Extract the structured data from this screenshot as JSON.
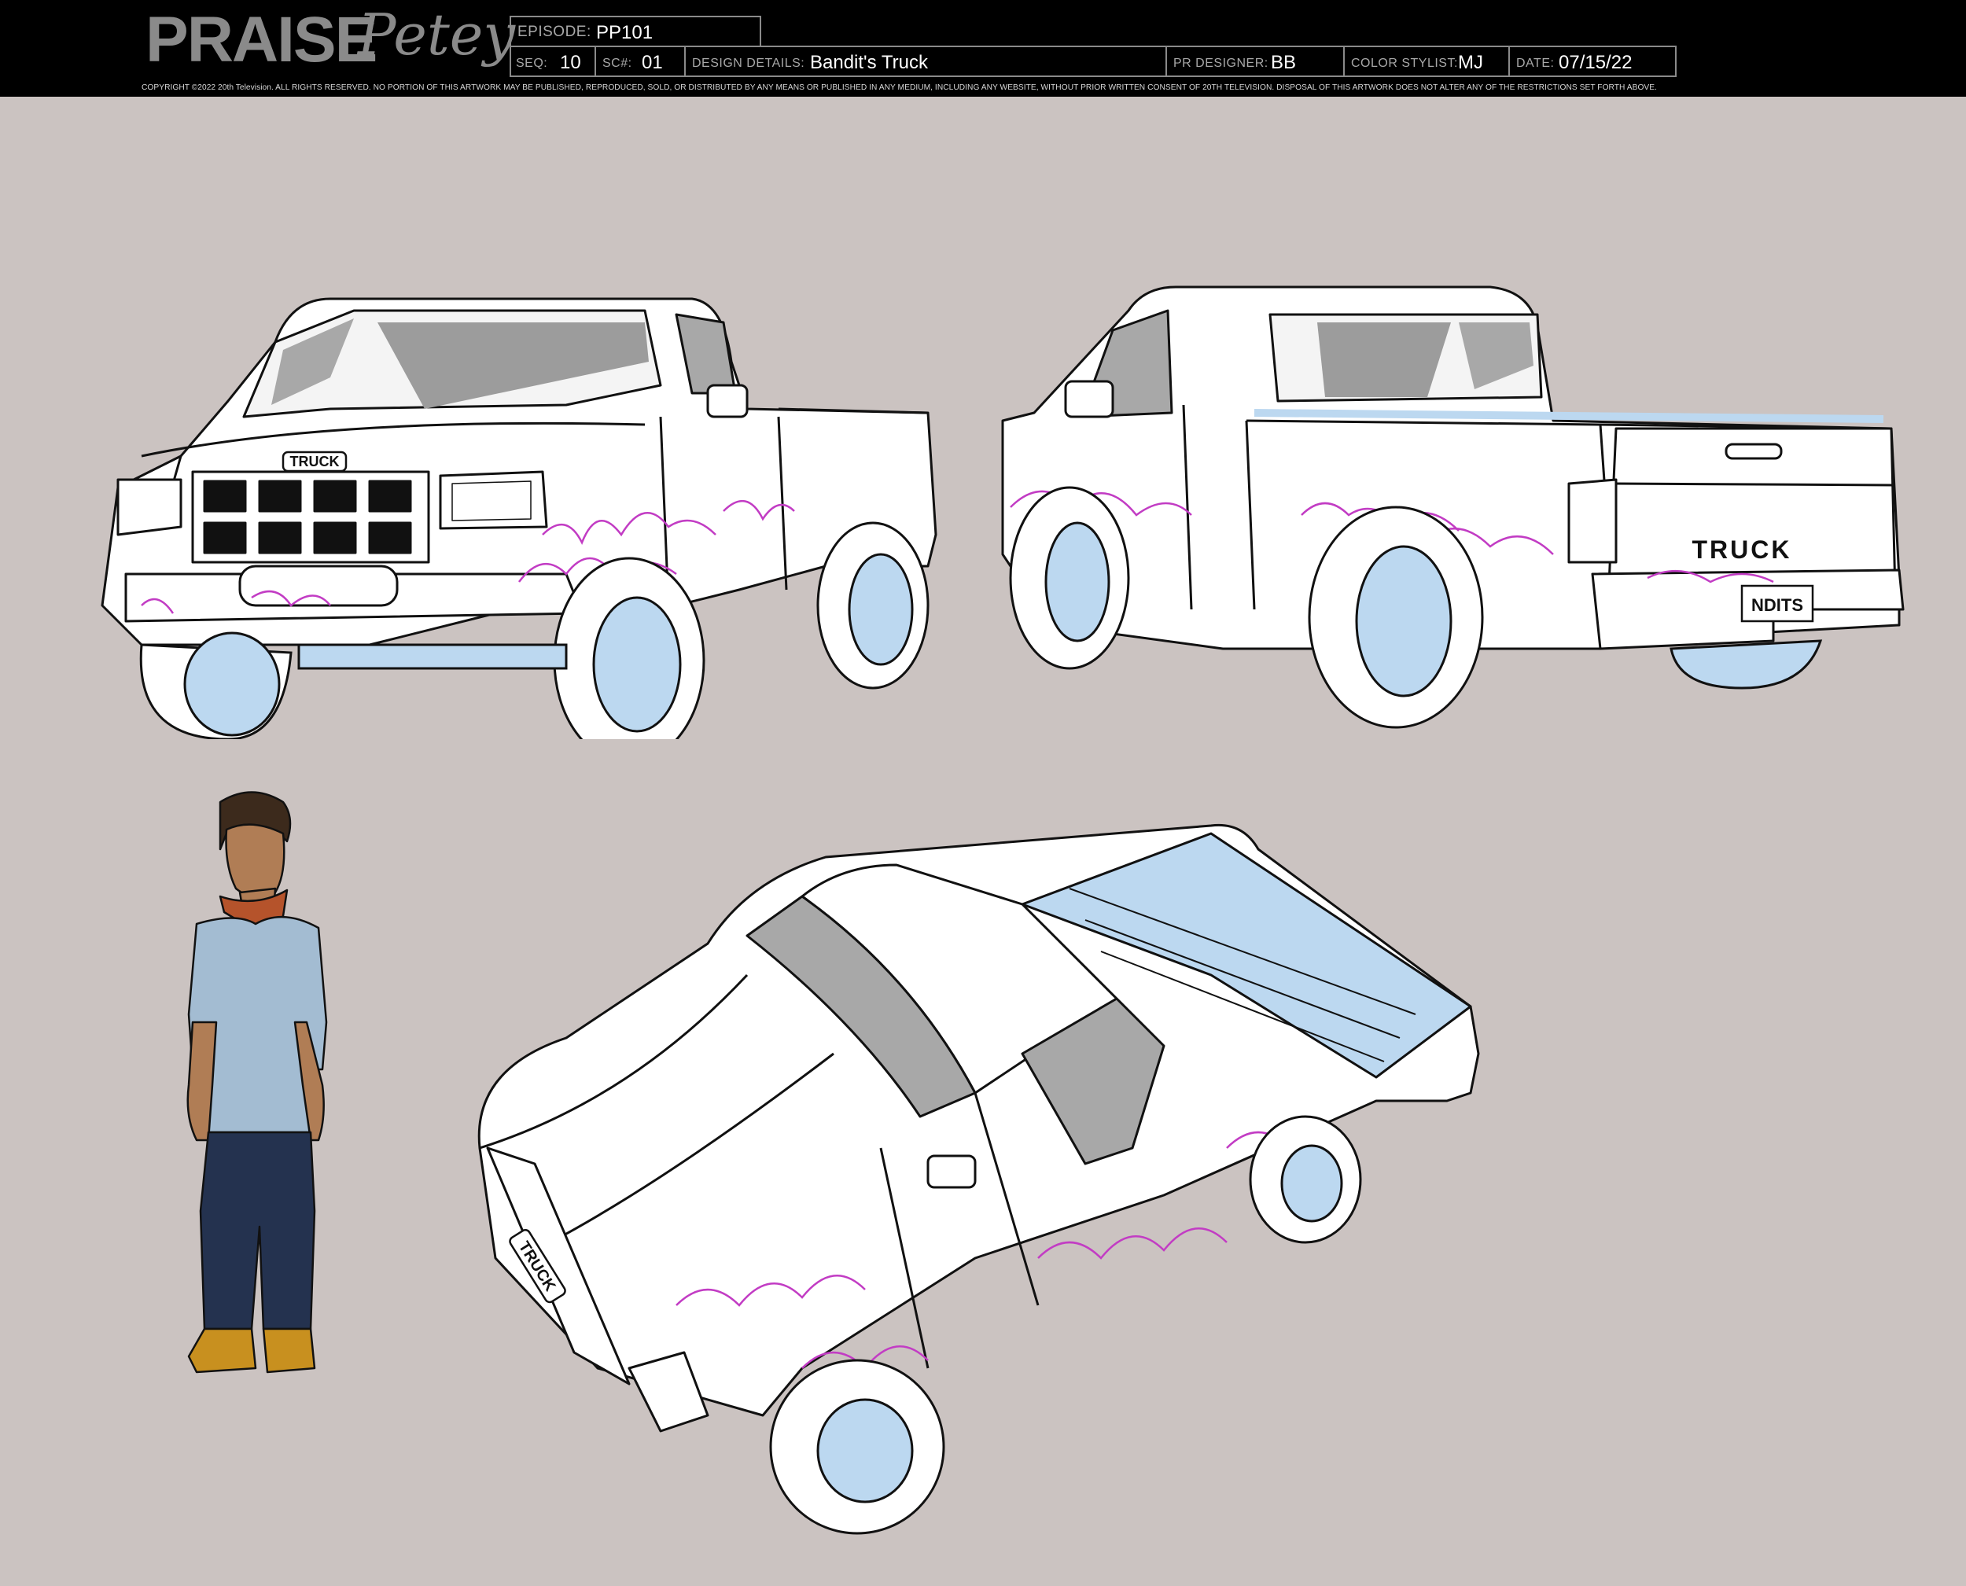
{
  "logo": {
    "word1": "PRAISE",
    "word2": "Petey"
  },
  "slate": {
    "episode_label": "EPISODE:",
    "episode_value": "PP101",
    "seq_label": "SEQ:",
    "seq_value": "10",
    "sc_label": "SC#:",
    "sc_value": "01",
    "design_label": "DESIGN DETAILS:",
    "design_value": "Bandit's Truck",
    "designer_label": "PR DESIGNER:",
    "designer_value": "BB",
    "stylist_label": "COLOR STYLIST:",
    "stylist_value": "MJ",
    "date_label": "DATE:",
    "date_value": "07/15/22"
  },
  "copyright": "COPYRIGHT ©2022 20th Television. ALL RIGHTS RESERVED. NO PORTION OF THIS ARTWORK MAY BE PUBLISHED, REPRODUCED, SOLD, OR DISTRIBUTED BY ANY MEANS OR PUBLISHED IN ANY MEDIUM, INCLUDING ANY WEBSITE, WITHOUT PRIOR WRITTEN CONSENT OF 20TH TELEVISION. DISPOSAL OF THIS ARTWORK DOES NOT ALTER ANY OF THE RESTRICTIONS SET FORTH ABOVE.",
  "truck_labels": {
    "front_grille_badge": "TRUCK",
    "rear_tailgate": "TRUCK",
    "rear_plate": "NDITS",
    "topdown_grille_badge": "TRUCK"
  },
  "colors": {
    "background": "#cbc3c1",
    "header": "#000000",
    "wheel_blue": "#bcd8f0",
    "graffiti_magenta": "#c23cc4",
    "shirt_blue": "#a3bcd2",
    "jeans_navy": "#24324f",
    "bandana_rust": "#b5532b",
    "boots_tan": "#c8901f",
    "skin_tan": "#b07d55"
  }
}
